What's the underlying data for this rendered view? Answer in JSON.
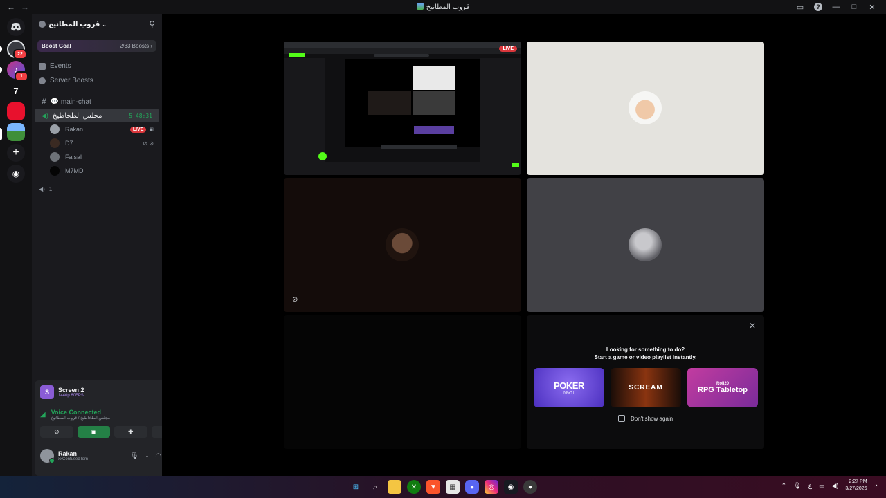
{
  "window": {
    "title": "قروب المطانيخ",
    "back_icon": "←",
    "forward_icon": "→"
  },
  "rail": {
    "badges": [
      "22",
      "1"
    ],
    "number_server": "7"
  },
  "server": {
    "name": "قروب المطانيخ",
    "boost_label": "Boost Goal",
    "boost_count": "2/33 Boosts ›"
  },
  "menu": {
    "events": "Events",
    "server_boosts": "Server Boosts"
  },
  "channels": {
    "text": "💬 main-chat",
    "voice": "مجلس الطخاطيخ",
    "voice_timer": "5:48:31",
    "other_voice_count": "1"
  },
  "voice_users": [
    {
      "name": "Rakan",
      "live": "LIVE"
    },
    {
      "name": "D7"
    },
    {
      "name": "Faisal"
    },
    {
      "name": "M7MD"
    }
  ],
  "stream_panel": {
    "title": "Screen 2",
    "quality": "1440p 60FPS",
    "icon_letter": "S",
    "voice_status": "Voice Connected",
    "voice_location": "مجلس الطخاطيخ / قروب المطانيخ"
  },
  "user": {
    "name": "Rakan",
    "status": "xxConfusedTom"
  },
  "stage": {
    "live_tag": "LIVE",
    "suggest_line1": "Looking for something to do?",
    "suggest_line2": "Start a game or video playlist instantly.",
    "cards": [
      "POKER",
      "SCREAM",
      "RPG Tabletop"
    ],
    "poker_sub": "NIGHT",
    "rpg_brand": "Roll20",
    "dont_show": "Don't show again"
  },
  "taskbar": {
    "time": "2:27 PM",
    "date": "3/27/2026",
    "lang": "ع"
  },
  "colors": {
    "accent_green": "#23a55a",
    "live_red": "#da373c",
    "blurple": "#5865f2"
  }
}
